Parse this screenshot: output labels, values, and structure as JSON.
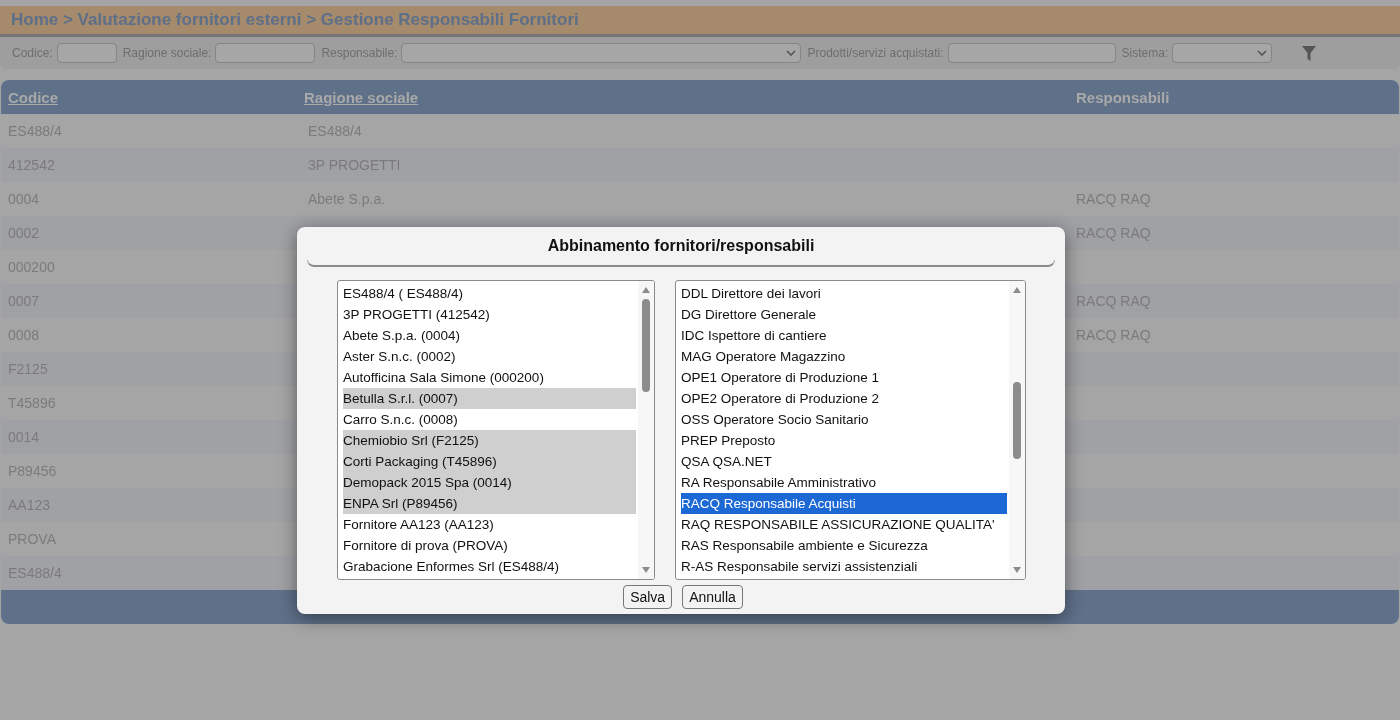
{
  "breadcrumb": "Home > Valutazione fornitori esterni > Gestione Responsabili Fornitori",
  "filters": [
    {
      "label": "Codice:",
      "kind": "text"
    },
    {
      "label": "Ragione sociale:",
      "kind": "text"
    },
    {
      "label": "Responsabile:",
      "kind": "select"
    },
    {
      "label": "Prodotti/servizi acquistati:",
      "kind": "text"
    },
    {
      "label": "Sistema:",
      "kind": "select"
    }
  ],
  "table": {
    "columns": [
      {
        "label": "Codice",
        "link": true
      },
      {
        "label": "Ragione sociale",
        "link": true
      },
      {
        "label": "Responsabili",
        "link": false
      }
    ],
    "rows": [
      {
        "codice": "ES488/4",
        "ragione_sociale": "ES488/4"
      },
      {
        "codice": "412542",
        "ragione_sociale": "3P PROGETTI"
      },
      {
        "codice": "0004",
        "ragione_sociale": "Abete S.p.a.",
        "responsabili": "RACQ RAQ"
      },
      {
        "codice": "0002",
        "responsabili": "RACQ RAQ"
      },
      {
        "codice": "000200"
      },
      {
        "codice": "0007",
        "responsabili": "RACQ RAQ"
      },
      {
        "codice": "0008",
        "responsabili": "RACQ RAQ"
      },
      {
        "codice": "F2125"
      },
      {
        "codice": "T45896"
      },
      {
        "codice": "0014"
      },
      {
        "codice": "P89456"
      },
      {
        "codice": "AA123"
      },
      {
        "codice": "PROVA"
      },
      {
        "codice": "ES488/4"
      }
    ]
  },
  "modal": {
    "title": "Abbinamento fornitori/responsabili",
    "suppliers": [
      {
        "label": "ES488/4 ( ES488/4)",
        "selected": false
      },
      {
        "label": "3P PROGETTI (412542)",
        "selected": false
      },
      {
        "label": "Abete S.p.a. (0004)",
        "selected": false
      },
      {
        "label": "Aster S.n.c. (0002)",
        "selected": false
      },
      {
        "label": "Autofficina Sala Simone (000200)",
        "selected": false
      },
      {
        "label": "Betulla S.r.l. (0007)",
        "selected": true
      },
      {
        "label": "Carro S.n.c. (0008)",
        "selected": false
      },
      {
        "label": "Chemiobio Srl (F2125)",
        "selected": true
      },
      {
        "label": "Corti Packaging (T45896)",
        "selected": true
      },
      {
        "label": "Demopack 2015 Spa (0014)",
        "selected": true
      },
      {
        "label": "ENPA Srl (P89456)",
        "selected": true
      },
      {
        "label": "Fornitore AA123 (AA123)",
        "selected": false
      },
      {
        "label": "Fornitore di prova (PROVA)",
        "selected": false
      },
      {
        "label": "Grabacione Enformes Srl (ES488/4)",
        "selected": false
      }
    ],
    "roles": [
      {
        "label": "DDL Direttore dei lavori",
        "selected": false
      },
      {
        "label": "DG Direttore Generale",
        "selected": false
      },
      {
        "label": "IDC Ispettore di cantiere",
        "selected": false
      },
      {
        "label": "MAG Operatore Magazzino",
        "selected": false
      },
      {
        "label": "OPE1 Operatore di Produzione 1",
        "selected": false
      },
      {
        "label": "OPE2 Operatore di Produzione 2",
        "selected": false
      },
      {
        "label": "OSS Operatore Socio Sanitario",
        "selected": false
      },
      {
        "label": "PREP Preposto",
        "selected": false
      },
      {
        "label": "QSA QSA.NET",
        "selected": false
      },
      {
        "label": "RA Responsabile Amministrativo",
        "selected": false
      },
      {
        "label": "RACQ Responsabile Acquisti",
        "selected": true
      },
      {
        "label": "RAQ RESPONSABILE ASSICURAZIONE QUALITA'",
        "selected": false
      },
      {
        "label": "RAS Responsabile ambiente e Sicurezza",
        "selected": false
      },
      {
        "label": "R-AS Responsabile servizi assistenziali",
        "selected": false
      }
    ],
    "buttons": [
      "Salva",
      "Annulla"
    ]
  }
}
